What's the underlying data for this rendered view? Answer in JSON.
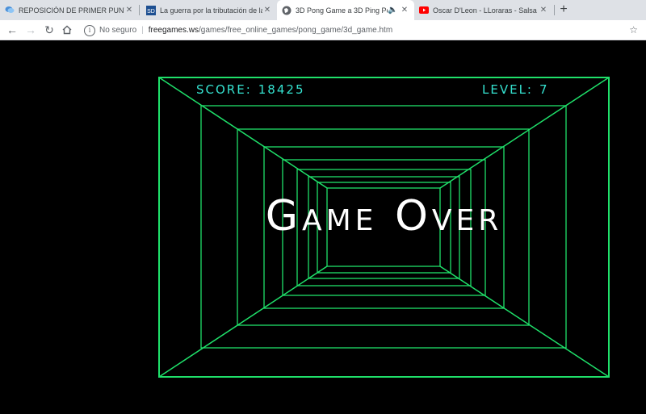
{
  "tabs": [
    {
      "title": "REPOSICIÓN DE PRIMER PUNTUA",
      "icon": "chat-bubble-icon",
      "active": false
    },
    {
      "title": "La guerra por la tributación de la",
      "icon": "sd-logo-icon",
      "active": false
    },
    {
      "title": "3D Pong Game a 3D Ping Po",
      "icon": "globe-icon",
      "active": true,
      "audio": true
    },
    {
      "title": "Oscar D'Leon - LLoraras - Salsa (",
      "icon": "youtube-icon",
      "active": false
    }
  ],
  "toolbar": {
    "security_label": "No seguro",
    "url_host": "freegames.ws",
    "url_path": "/games/free_online_games/pong_game/3d_game.htm"
  },
  "game": {
    "score_label": "SCORE:",
    "score": "18425",
    "level_label": "LEVEL:",
    "level": "7",
    "message": "Game Over"
  },
  "colors": {
    "grid": "#1fe06a",
    "hud": "#35e2d0",
    "message": "#ffffff"
  }
}
